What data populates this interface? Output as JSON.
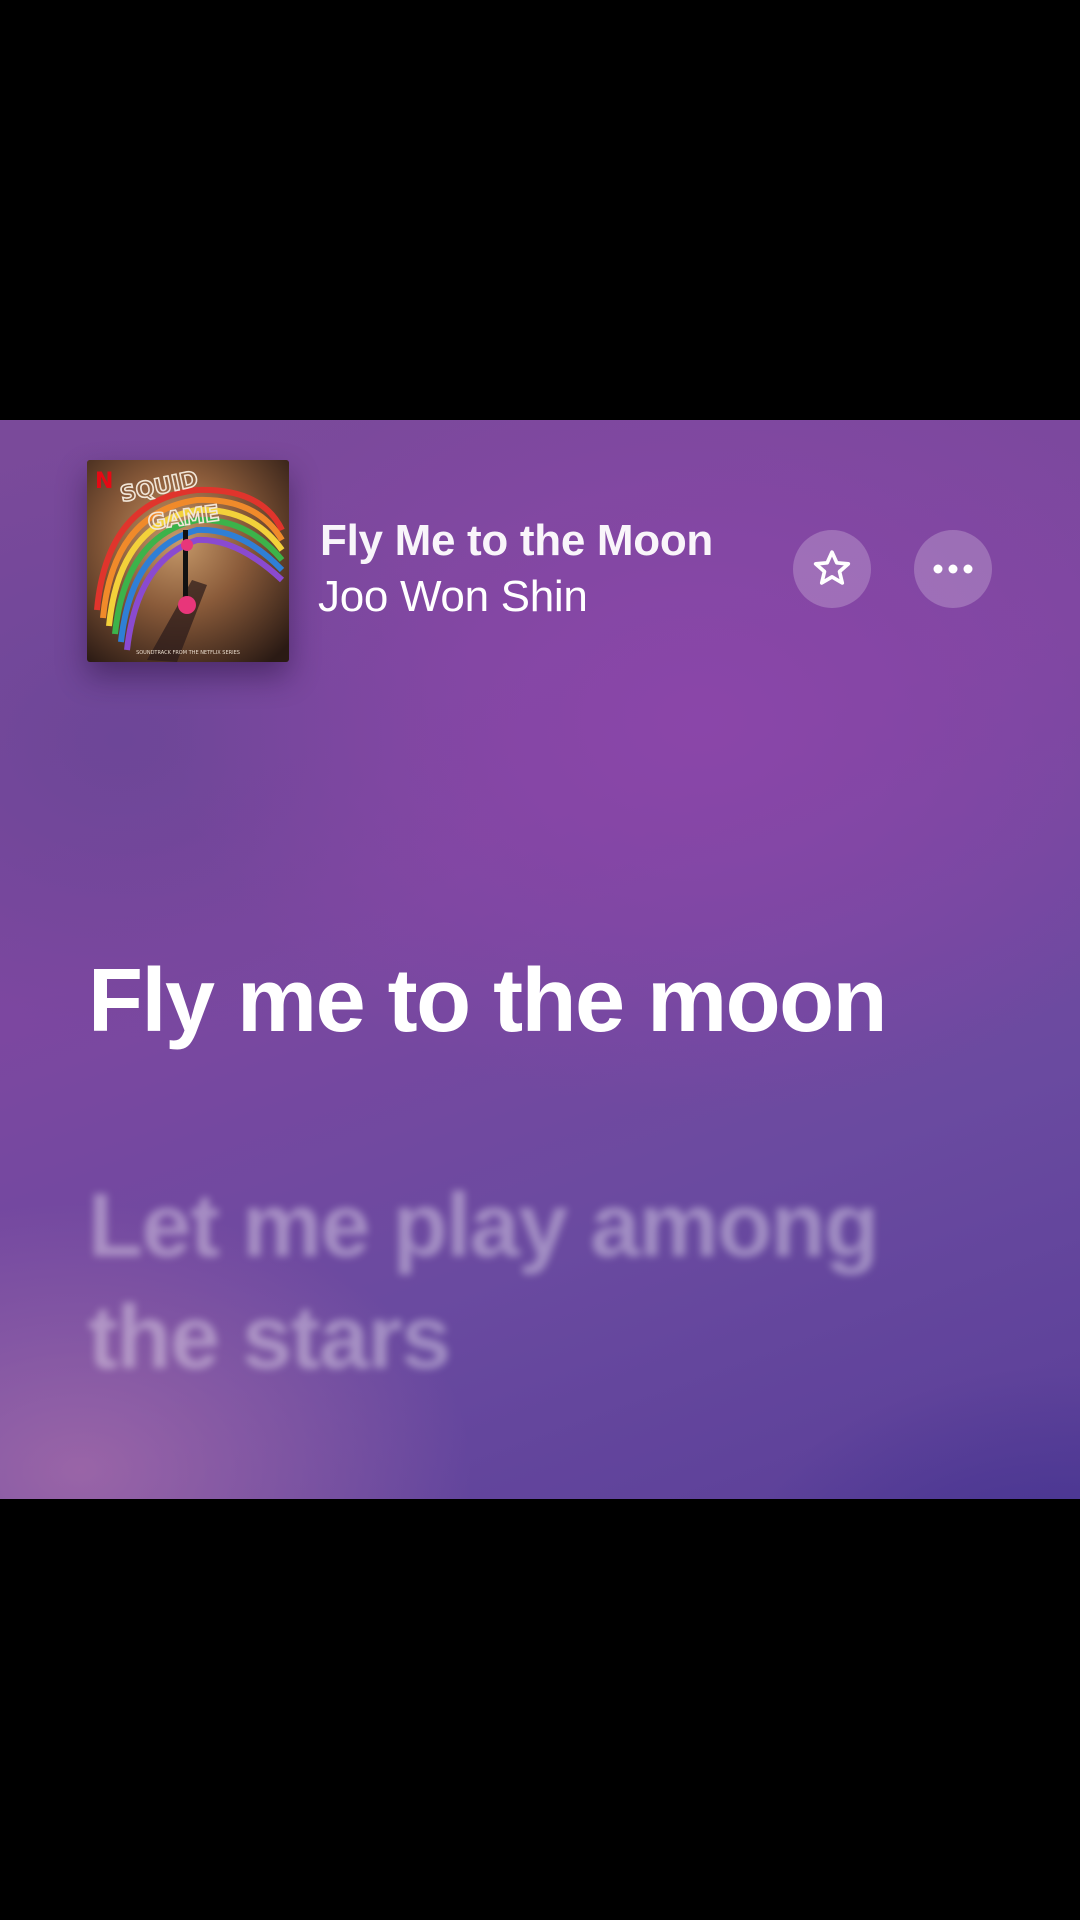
{
  "now_playing": {
    "title": "Fly Me to the Moon",
    "artist": "Joo Won Shin",
    "artwork": {
      "netflix_mark": "N",
      "logo_text": "SQUID GAME",
      "caption": "SOUNDTRACK FROM THE NETFLIX SERIES"
    }
  },
  "actions": {
    "favorite_icon": "star-outline-icon",
    "more_icon": "ellipsis-icon"
  },
  "lyrics": {
    "current": "Fly me to the moon",
    "next": "Let me play among the stars"
  },
  "colors": {
    "background_primary": "#7d47a0",
    "background_accent": "#3a2e8c",
    "text_primary": "#ffffff",
    "button_fill": "rgba(255,255,255,0.22)"
  }
}
